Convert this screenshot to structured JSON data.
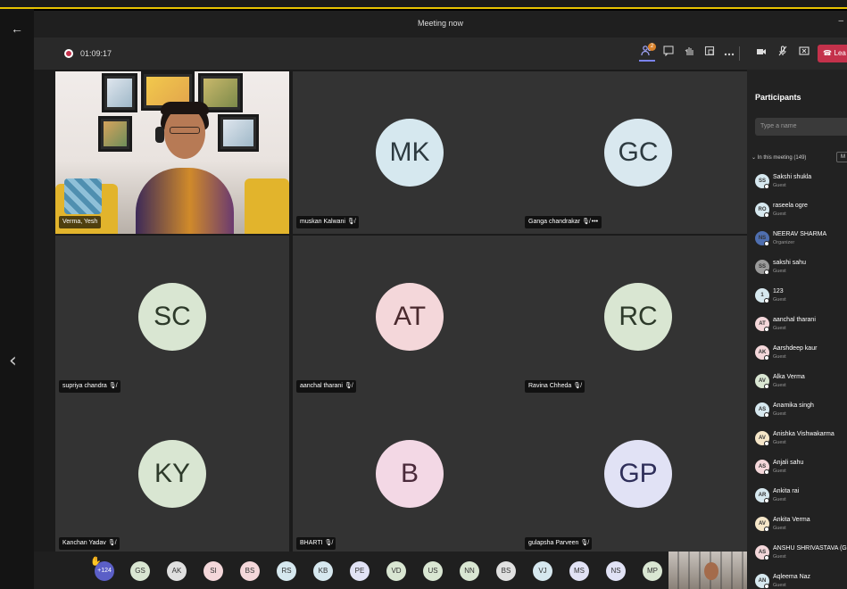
{
  "window": {
    "title": "Meeting now",
    "minimize_glyph": "–",
    "back_glyph": "←",
    "prev_glyph": "‹"
  },
  "toolbar": {
    "elapsed": "01:09:17",
    "participants_badge": "2",
    "leave_label": "Lea",
    "icons": [
      "participants-icon",
      "chat-icon",
      "raise-hand-icon",
      "breakout-icon",
      "more-icon",
      "camera-icon",
      "mic-off-icon",
      "share-icon"
    ]
  },
  "tiles": [
    {
      "name": "Verma, Yesh",
      "initials": "",
      "video": true
    },
    {
      "name": "muskan Kalwani",
      "initials": "MK",
      "color": "#d6e8ef",
      "text": "#2d3a40"
    },
    {
      "name": "Ganga chandrakar",
      "initials": "GC",
      "color": "#d9e8ef",
      "text": "#2d3a40",
      "more": "•••"
    },
    {
      "name": "supriya chandra",
      "initials": "SC",
      "color": "#d9e6d2",
      "text": "#2d3a2a"
    },
    {
      "name": "aanchal tharani",
      "initials": "AT",
      "color": "#f4d7da",
      "text": "#4a2a2e"
    },
    {
      "name": "Ravina Chheda",
      "initials": "RC",
      "color": "#d9e6d2",
      "text": "#2d3a2a"
    },
    {
      "name": "Kanchan Yadav",
      "initials": "KY",
      "color": "#d9e6d2",
      "text": "#2d3a2a"
    },
    {
      "name": "BHARTI",
      "initials": "B",
      "color": "#f3d8e5",
      "text": "#4a2a3a"
    },
    {
      "name": "gulapsha Parveen",
      "initials": "GP",
      "color": "#e1e2f5",
      "text": "#2f2f5a"
    }
  ],
  "strip": {
    "more_count": "+124",
    "avatars": [
      {
        "initials": "GS",
        "color": "#d9e6d2"
      },
      {
        "initials": "AK",
        "color": "#e0e0e0"
      },
      {
        "initials": "SI",
        "color": "#f4d7da"
      },
      {
        "initials": "BS",
        "color": "#f4d7da"
      },
      {
        "initials": "RS",
        "color": "#d6e8ef"
      },
      {
        "initials": "KB",
        "color": "#d6e8ef"
      },
      {
        "initials": "PE",
        "color": "#e1e2f5"
      },
      {
        "initials": "VD",
        "color": "#d9e6d2"
      },
      {
        "initials": "US",
        "color": "#d9e6d2"
      },
      {
        "initials": "NN",
        "color": "#d9e6d2"
      },
      {
        "initials": "BS",
        "color": "#e0e0e0"
      },
      {
        "initials": "VJ",
        "color": "#d6e8ef"
      },
      {
        "initials": "MS",
        "color": "#e1e2f5"
      },
      {
        "initials": "NS",
        "color": "#e1e2f5"
      },
      {
        "initials": "MP",
        "color": "#d9e6d2"
      }
    ]
  },
  "participants": {
    "title": "Participants",
    "search_placeholder": "Type a name",
    "section_label": "In this meeting (149)",
    "section_chevron": "⌄",
    "more_button": "M",
    "list": [
      {
        "initials": "SS",
        "name": "Sakshi shukla",
        "role": "Guest",
        "color": "#d6e8ef"
      },
      {
        "initials": "RO",
        "name": "raseela ogre",
        "role": "Guest",
        "color": "#d6e8ef"
      },
      {
        "initials": "NS",
        "name": "NEERAV SHARMA",
        "role": "Organizer",
        "color": "#4f6fb0"
      },
      {
        "initials": "SS",
        "name": "sakshi sahu",
        "role": "Guest",
        "color": "#9a9a9a"
      },
      {
        "initials": "1",
        "name": "123",
        "role": "Guest",
        "color": "#d6e8ef"
      },
      {
        "initials": "AT",
        "name": "aanchal tharani",
        "role": "Guest",
        "color": "#f4d7da"
      },
      {
        "initials": "AK",
        "name": "Aarshdeep kaur",
        "role": "Guest",
        "color": "#f4d7da"
      },
      {
        "initials": "AV",
        "name": "Alka Verma",
        "role": "Guest",
        "color": "#d9e6d2"
      },
      {
        "initials": "AS",
        "name": "Anamika singh",
        "role": "Guest",
        "color": "#d6e8ef"
      },
      {
        "initials": "AV",
        "name": "Anishka Vishwakarma",
        "role": "Guest",
        "color": "#f5e6c8"
      },
      {
        "initials": "AS",
        "name": "Anjali sahu",
        "role": "Guest",
        "color": "#f4d7da"
      },
      {
        "initials": "AR",
        "name": "Ankita rai",
        "role": "Guest",
        "color": "#d6e8ef"
      },
      {
        "initials": "AV",
        "name": "Ankita Verma",
        "role": "Guest",
        "color": "#f5e6c8"
      },
      {
        "initials": "AS",
        "name": "ANSHU SHRIVASTAVA (Gue",
        "role": "Guest",
        "color": "#f4d7da"
      },
      {
        "initials": "AN",
        "name": "Aqleema Naz",
        "role": "Guest",
        "color": "#d6e8ef"
      }
    ]
  }
}
